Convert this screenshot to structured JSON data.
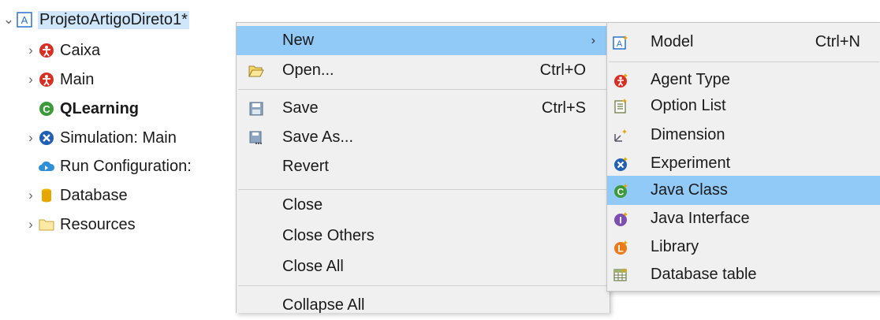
{
  "tree": {
    "project": "ProjetoArtigoDireto1*",
    "items": [
      {
        "label": "Caixa"
      },
      {
        "label": "Main"
      },
      {
        "label": "QLearning"
      },
      {
        "label": "Simulation: Main"
      },
      {
        "label": "Run Configuration:"
      },
      {
        "label": "Database"
      },
      {
        "label": "Resources"
      }
    ]
  },
  "context_menu": {
    "items": [
      {
        "label": "New",
        "arrow": "›"
      },
      {
        "label": "Open...",
        "shortcut": "Ctrl+O"
      },
      {
        "label": "Save",
        "shortcut": "Ctrl+S"
      },
      {
        "label": "Save As..."
      },
      {
        "label": "Revert"
      },
      {
        "label": "Close"
      },
      {
        "label": "Close Others"
      },
      {
        "label": "Close All"
      },
      {
        "label": "Collapse All"
      }
    ]
  },
  "submenu": {
    "items": [
      {
        "label": "Model",
        "shortcut": "Ctrl+N"
      },
      {
        "label": "Agent Type"
      },
      {
        "label": "Option List"
      },
      {
        "label": "Dimension"
      },
      {
        "label": "Experiment"
      },
      {
        "label": "Java Class"
      },
      {
        "label": "Java Interface"
      },
      {
        "label": "Library"
      },
      {
        "label": "Database table"
      }
    ]
  },
  "colors": {
    "highlight": "#91c9f7",
    "menu_bg": "#f0f0f0",
    "selection": "#cfe6fb"
  }
}
